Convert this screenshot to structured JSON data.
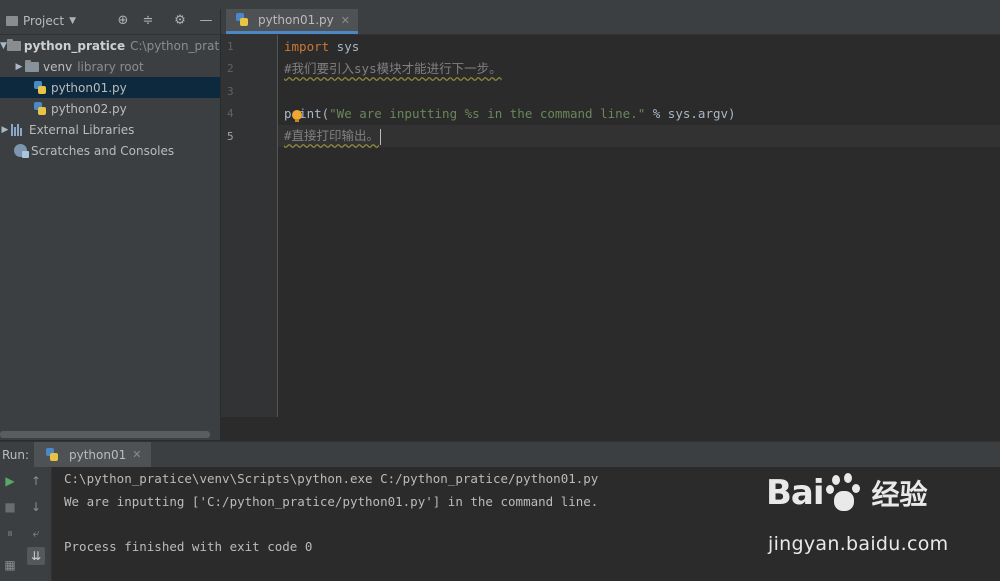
{
  "project_panel": {
    "title": "Project",
    "tree": [
      {
        "name": "python_pratice",
        "path": "C:\\python_pratic"
      },
      {
        "name": "venv",
        "tag": "library root"
      },
      {
        "name": "python01.py"
      },
      {
        "name": "python02.py"
      },
      {
        "name": "External Libraries"
      },
      {
        "name": "Scratches and Consoles"
      }
    ]
  },
  "editor": {
    "tab_label": "python01.py",
    "line_numbers": [
      "1",
      "2",
      "3",
      "4",
      "5"
    ],
    "lines": {
      "l1_kw": "import",
      "l1_rest": " sys",
      "l2": "#我们要引入sys模块才能进行下一步。",
      "l4_pre": "print(",
      "l4_str": "\"We are inputting %s in the command line.\"",
      "l4_post": " % sys.argv)",
      "l5": "#直接打印输出。"
    }
  },
  "run_panel": {
    "label": "Run:",
    "tab_label": "python01",
    "console": [
      "C:\\python_pratice\\venv\\Scripts\\python.exe C:/python_pratice/python01.py",
      "We are inputting ['C:/python_pratice/python01.py'] in the command line.",
      "",
      "Process finished with exit code 0"
    ]
  },
  "watermark": {
    "logo_left": "Bai",
    "logo_right": "经验",
    "url": "jingyan.baidu.com"
  },
  "colors": {
    "keyword": "#cc7832",
    "string": "#6a8759",
    "comment": "#808080",
    "selection": "#0d293e",
    "tab_underline": "#4a88c7"
  }
}
